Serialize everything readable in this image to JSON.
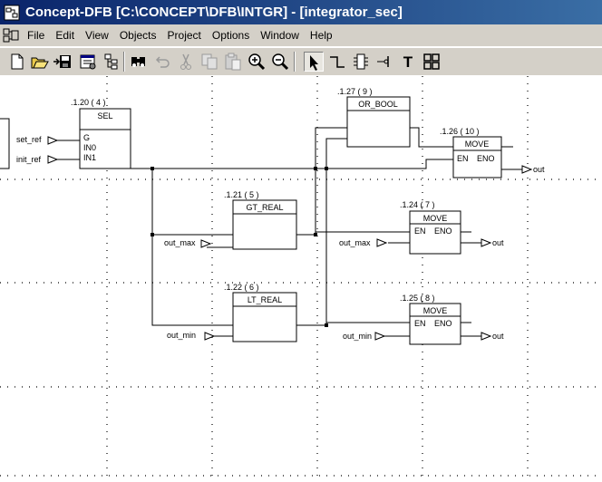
{
  "window": {
    "title": "Concept-DFB [C:\\CONCEPT\\DFB\\INTGR]  - [integrator_sec]"
  },
  "menu": [
    {
      "label": "File"
    },
    {
      "label": "Edit"
    },
    {
      "label": "View"
    },
    {
      "label": "Objects"
    },
    {
      "label": "Project"
    },
    {
      "label": "Options"
    },
    {
      "label": "Window"
    },
    {
      "label": "Help"
    }
  ],
  "toolbar": {
    "buttons": [
      "new-icon",
      "open-icon",
      "save-icon",
      "properties-icon",
      "hierarchy-icon",
      "find-icon",
      "undo-icon",
      "cut-icon",
      "copy-icon",
      "paste-icon",
      "zoom-in-icon",
      "zoom-out-icon",
      "select-pointer-icon",
      "link-icon",
      "ffb-icon",
      "pin-icon",
      "text-icon",
      "block-icon"
    ],
    "active": "select-pointer-icon",
    "text_tool": "T"
  },
  "diagram": {
    "blocks": {
      "sel": {
        "ref": ".1.20 ( 4 )",
        "name": "SEL",
        "pins": [
          "G",
          "IN0",
          "IN1"
        ]
      },
      "or_bool": {
        "ref": ".1.27 ( 9 )",
        "name": "OR_BOOL"
      },
      "move10": {
        "ref": ".1.26 ( 10 )",
        "name": "MOVE",
        "en": "EN",
        "eno": "ENO"
      },
      "gt_real": {
        "ref": ".1.21 ( 5 )",
        "name": "GT_REAL"
      },
      "move7": {
        "ref": ".1.24 ( 7 )",
        "name": "MOVE",
        "en": "EN",
        "eno": "ENO"
      },
      "lt_real": {
        "ref": ".1.22 ( 6 )",
        "name": "LT_REAL"
      },
      "move8": {
        "ref": ".1.25 ( 8 )",
        "name": "MOVE",
        "en": "EN",
        "eno": "ENO"
      }
    },
    "vars": {
      "set_ref": "set_ref",
      "init_ref": "init_ref",
      "out_max_in": "out_max",
      "out_max_move": "out_max",
      "out_min_in": "out_min",
      "out_min_move": "out_min",
      "out_top": "out",
      "out_mid": "out",
      "out_bot": "out"
    }
  }
}
